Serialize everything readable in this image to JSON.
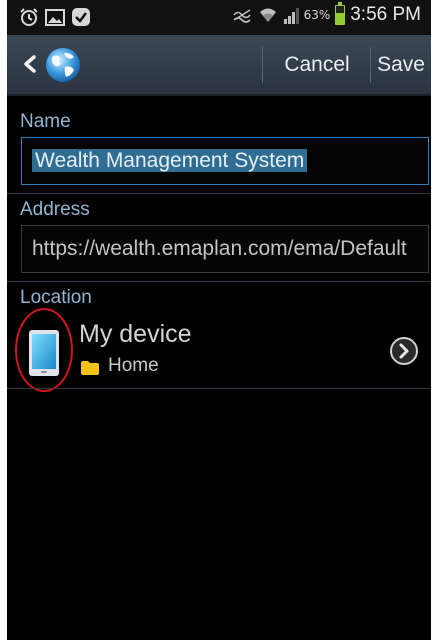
{
  "status_bar": {
    "battery_percent": "63%",
    "time": "3:56 PM",
    "battery_level": 0.63,
    "icons_left": [
      "alarm-clock-icon",
      "gallery-icon",
      "checkmark-icon"
    ],
    "icons_right": [
      "no-sim-icon",
      "wifi-icon",
      "signal-icon",
      "battery-icon"
    ]
  },
  "action_bar": {
    "back_icon": "chevron-left-icon",
    "app_icon": "globe-icon",
    "cancel_label": "Cancel",
    "save_label": "Save"
  },
  "form": {
    "name": {
      "label": "Name",
      "value": "Wealth Management System"
    },
    "address": {
      "label": "Address",
      "value": "https://wealth.emaplan.com/ema/Default"
    },
    "location": {
      "label": "Location",
      "title": "My device",
      "folder": "Home",
      "device_icon": "tablet-icon",
      "folder_icon": "folder-icon",
      "chevron_icon": "chevron-right-circle-icon"
    }
  },
  "colors": {
    "background": "#000000",
    "action_bar": "#34414e",
    "label_blue": "#8fb6d4",
    "selection": "#2f6d93",
    "highlight_circle": "#d2141c",
    "folder": "#f3c21a"
  }
}
